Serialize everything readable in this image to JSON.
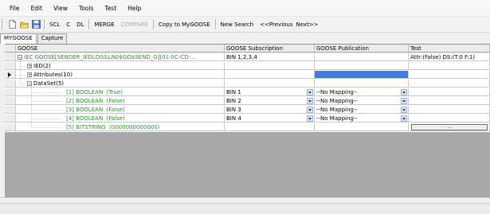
{
  "menu": [
    "File",
    "Edit",
    "View",
    "Tools",
    "Test",
    "Help"
  ],
  "toolbar": {
    "scl": "SCL",
    "c": "C",
    "dl": "DL",
    "merge": "MERGE",
    "compare": "COMPARE",
    "copy": "Copy to MyGOOSE",
    "new_search": "New Search",
    "prev": "<<Previous",
    "next": "Next>>"
  },
  "tabs": [
    "MYGOOSE",
    "Capture"
  ],
  "grid": {
    "columns": [
      "GOOSE",
      "GOOSE Subscription",
      "GOOSE Publication",
      "Test"
    ],
    "root": {
      "label": "IEC GOOSE[SENDER_IEDLD0/LLN0$GO$SEND_G][01-0C-CD-...",
      "subscription": "BIN 1,2,3,4",
      "test": "Attr:(False) DS:(T:0 F:1)"
    },
    "ied": "IED(2)",
    "attributes": "Attributes(10)",
    "dataset": "DataSet(5)",
    "items": [
      {
        "label": "[1] BOOLEAN",
        "value": "(True)",
        "sub": "BIN 1",
        "pub": "--No Mapping--"
      },
      {
        "label": "[2] BOOLEAN",
        "value": "(False)",
        "sub": "BIN 2",
        "pub": "--No Mapping--"
      },
      {
        "label": "[3] BOOLEAN",
        "value": "(False)",
        "sub": "BIN 3",
        "pub": "--No Mapping--"
      },
      {
        "label": "[4] BOOLEAN",
        "value": "(False)",
        "sub": "BIN 4",
        "pub": "--No Mapping--"
      }
    ],
    "bitstring": {
      "label": "[5] BITSTRING",
      "value": "(0000000000000)",
      "button": "..."
    }
  },
  "colors": {
    "tree_text": "#2f8b2f",
    "selection": "#3c7fe0",
    "grid_empty": "#a9a9a9"
  }
}
